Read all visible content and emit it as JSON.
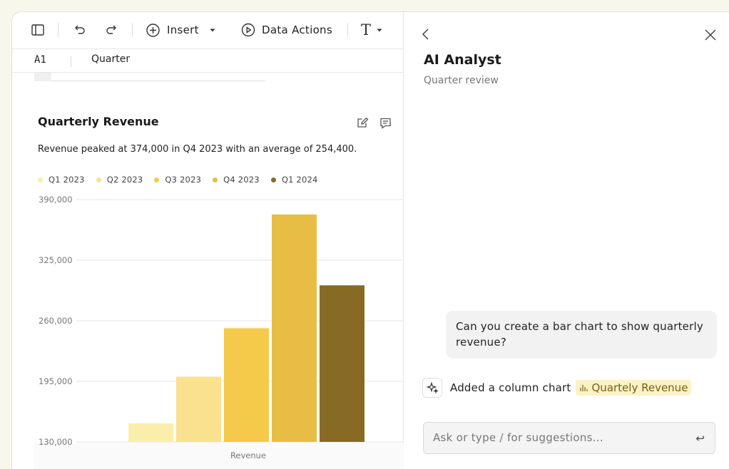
{
  "toolbar": {
    "insert_label": "Insert",
    "data_actions_label": "Data Actions",
    "text_format_label": "T"
  },
  "formula_bar": {
    "cell_ref": "A1",
    "cell_value": "Quarter"
  },
  "chart_card": {
    "title": "Quarterly Revenue",
    "summary": "Revenue peaked at 374,000 in Q4 2023 with an average of 254,400."
  },
  "chart_data": {
    "type": "bar",
    "categories": [
      "Q1 2023",
      "Q2 2023",
      "Q3 2023",
      "Q4 2023",
      "Q1 2024"
    ],
    "values": [
      150000,
      200000,
      252000,
      374000,
      298000
    ],
    "colors": [
      "#fbeeaa",
      "#f9e18f",
      "#f5c94a",
      "#e7be43",
      "#876b24"
    ],
    "xlabel": "Revenue",
    "ylabel": "",
    "ylim": [
      130000,
      390000
    ],
    "yticks": [
      "390,000",
      "325,000",
      "260,000",
      "195,000",
      "130,000"
    ],
    "ytick_values": [
      390000,
      325000,
      260000,
      195000,
      130000
    ],
    "grid": true,
    "legend": "top-left"
  },
  "panel": {
    "title": "AI Analyst",
    "subtitle": "Quarter review",
    "user_message": "Can you create a bar chart to show quarterly revenue?",
    "ai_message": "Added a column chart",
    "chip_label": "Quartely Revenue",
    "input_placeholder": "Ask or type / for suggestions...",
    "enter_symbol": "↩"
  }
}
